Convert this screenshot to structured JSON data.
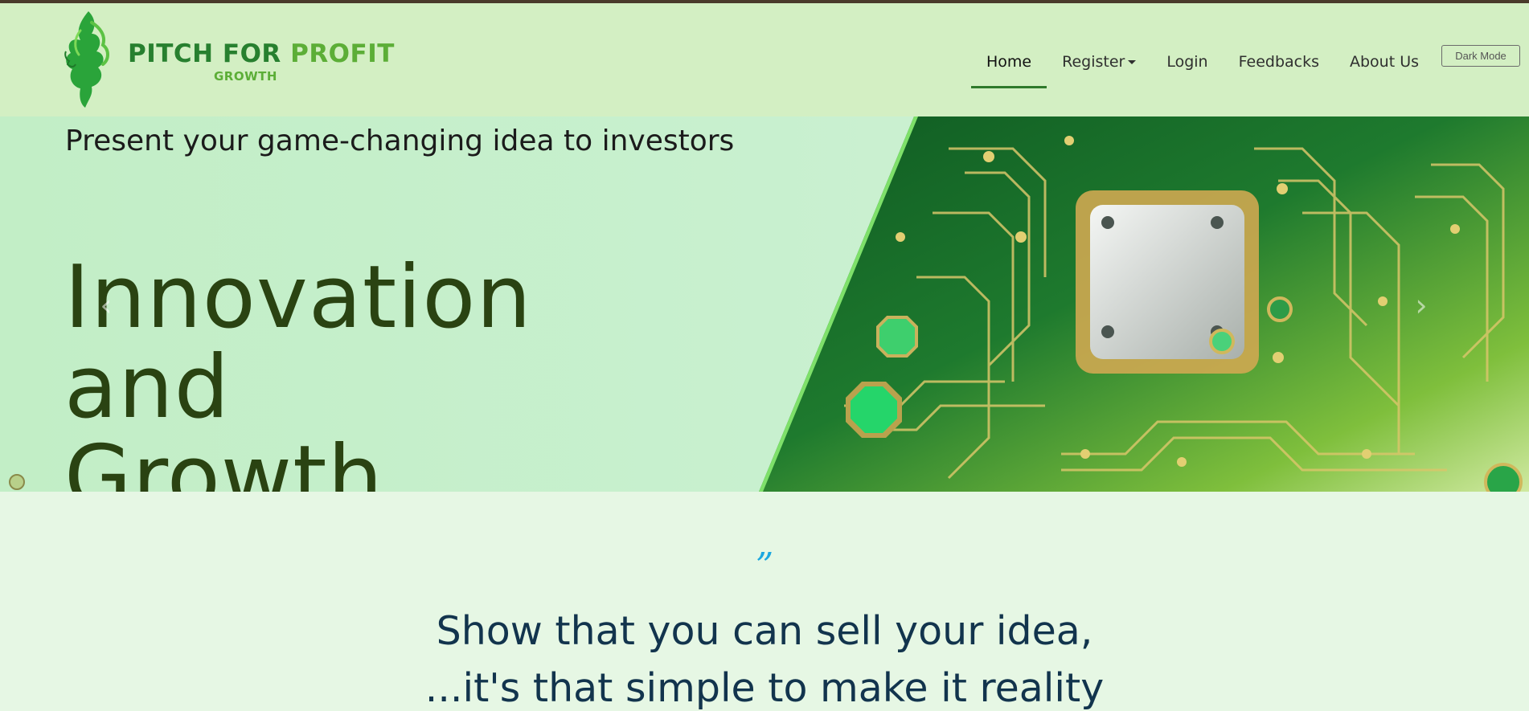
{
  "brand": {
    "name_part1": "PITCH FOR",
    "name_part2": "PROFIT",
    "subtitle": "GROWTH",
    "logo_icon": "leaf-woman-icon"
  },
  "nav": {
    "items": [
      {
        "label": "Home",
        "active": true
      },
      {
        "label": "Register",
        "dropdown": true
      },
      {
        "label": "Login"
      },
      {
        "label": "Feedbacks"
      },
      {
        "label": "About Us"
      }
    ],
    "dark_mode_label": "Dark Mode"
  },
  "hero": {
    "tagline": "Present your game-changing idea to investors",
    "title_line1": "Innovation and",
    "title_line2": "Growth",
    "prev_icon": "chevron-left-icon",
    "next_icon": "chevron-right-icon"
  },
  "quote": {
    "mark": "”",
    "line1": "Show that you can sell your idea,",
    "line2": "...it's that simple to make it reality"
  },
  "colors": {
    "navbar_bg": "#d3efc3",
    "brand_green": "#27802f",
    "accent_blue": "#1ba7e0",
    "quote_text": "#12344d"
  }
}
